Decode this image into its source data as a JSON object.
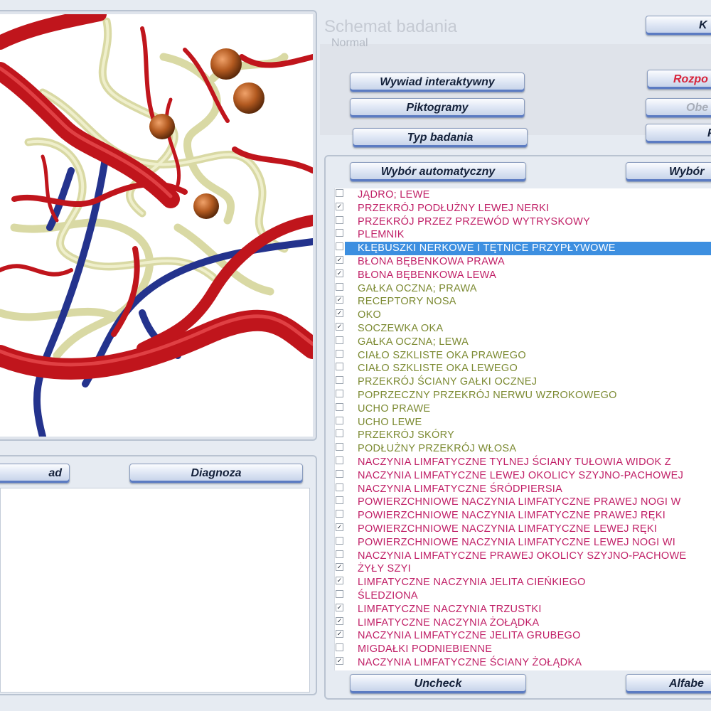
{
  "header": {
    "title": "Schemat badania",
    "subtitle": "Normal",
    "top_button": "K"
  },
  "buttons": {
    "interactive": "Wywiad interaktywny",
    "pictograms": "Piktogramy",
    "exam_type": "Typ badania",
    "auto": "Wybór automatyczny",
    "manual": "Wybór",
    "start": "Rozpo",
    "observe": "Obe",
    "right3": "P",
    "left_bottom": "ad",
    "diagnosis": "Diagnoza",
    "uncheck": "Uncheck",
    "alpha": "Alfabe"
  },
  "colors": {
    "selected_row": "#3d8fe0",
    "organ_text": "#7c8a32",
    "vessel_text": "#c01f66",
    "artery": "#c0151c",
    "vein": "#24338d",
    "lymph": "#e8e8b8",
    "node": "#b35a20"
  },
  "items": [
    {
      "label": "JĄDRO;  LEWE",
      "checked": false,
      "color": "#c01f66"
    },
    {
      "label": "PRZEKRÓJ PODŁUŻNY LEWEJ NERKI",
      "checked": true,
      "color": "#c01f66"
    },
    {
      "label": "PRZEKRÓJ PRZEZ PRZEWÓD WYTRYSKOWY",
      "checked": false,
      "color": "#c01f66"
    },
    {
      "label": "PLEMNIK",
      "checked": false,
      "color": "#c01f66"
    },
    {
      "label": "KŁĘBUSZKI NERKOWE I TĘTNICE PRZYPŁYWOWE",
      "checked": false,
      "color": "#ffffff",
      "selected": true
    },
    {
      "label": "BŁONA BĘBENKOWA PRAWA",
      "checked": true,
      "color": "#c01f66"
    },
    {
      "label": "BŁONA BĘBENKOWA LEWA",
      "checked": true,
      "color": "#c01f66"
    },
    {
      "label": "GAŁKA OCZNA;  PRAWA",
      "checked": false,
      "color": "#7c8a32"
    },
    {
      "label": "RECEPTORY NOSA",
      "checked": true,
      "color": "#7c8a32"
    },
    {
      "label": "OKO",
      "checked": true,
      "color": "#7c8a32"
    },
    {
      "label": "SOCZEWKA OKA",
      "checked": true,
      "color": "#7c8a32"
    },
    {
      "label": "GAŁKA OCZNA;  LEWA",
      "checked": false,
      "color": "#7c8a32"
    },
    {
      "label": "CIAŁO SZKLISTE OKA PRAWEGO",
      "checked": false,
      "color": "#7c8a32"
    },
    {
      "label": "CIAŁO SZKLISTE OKA LEWEGO",
      "checked": false,
      "color": "#7c8a32"
    },
    {
      "label": "PRZEKRÓJ ŚCIANY GAŁKI OCZNEJ",
      "checked": false,
      "color": "#7c8a32"
    },
    {
      "label": "POPRZECZNY PRZEKRÓJ NERWU WZROKOWEGO",
      "checked": false,
      "color": "#7c8a32"
    },
    {
      "label": "UCHO PRAWE",
      "checked": false,
      "color": "#7c8a32"
    },
    {
      "label": "UCHO LEWE",
      "checked": false,
      "color": "#7c8a32"
    },
    {
      "label": "PRZEKRÓJ SKÓRY",
      "checked": false,
      "color": "#7c8a32"
    },
    {
      "label": "PODŁUŻNY  PRZEKRÓJ  WŁOSA",
      "checked": false,
      "color": "#7c8a32"
    },
    {
      "label": "NACZYNIA LIMFATYCZNE TYLNEJ ŚCIANY TUŁOWIA WIDOK Z",
      "checked": false,
      "color": "#c01f66"
    },
    {
      "label": "NACZYNIA LIMFATYCZNE LEWEJ OKOLICY SZYJNO-PACHOWEJ",
      "checked": false,
      "color": "#c01f66"
    },
    {
      "label": "NACZYNIA LIMFATYCZNE ŚRÓDPIERSIA",
      "checked": false,
      "color": "#c01f66"
    },
    {
      "label": "POWIERZCHNIOWE NACZYNIA LIMFATYCZNE PRAWEJ NOGI W",
      "checked": false,
      "color": "#c01f66"
    },
    {
      "label": "POWIERZCHNIOWE NACZYNIA LIMFATYCZNE PRAWEJ RĘKI",
      "checked": false,
      "color": "#c01f66"
    },
    {
      "label": "POWIERZCHNIOWE NACZYNIA LIMFATYCZNE LEWEJ RĘKI",
      "checked": true,
      "color": "#c01f66"
    },
    {
      "label": "POWIERZCHNIOWE NACZYNIA LIMFATYCZNE LEWEJ NOGI WI",
      "checked": false,
      "color": "#c01f66"
    },
    {
      "label": "NACZYNIA LIMFATYCZNE PRAWEJ OKOLICY SZYJNO-PACHOWE",
      "checked": false,
      "color": "#c01f66"
    },
    {
      "label": "ŻYŁY SZYI",
      "checked": true,
      "color": "#c01f66"
    },
    {
      "label": "LIMFATYCZNE NACZYNIA JELITA CIEŃKIEGO",
      "checked": true,
      "color": "#c01f66"
    },
    {
      "label": "ŚLEDZIONA",
      "checked": false,
      "color": "#c01f66"
    },
    {
      "label": "LIMFATYCZNE NACZYNIA TRZUSTKI",
      "checked": true,
      "color": "#c01f66"
    },
    {
      "label": "LIMFATYCZNE NACZYNIA ŻOŁĄDKA",
      "checked": true,
      "color": "#c01f66"
    },
    {
      "label": "NACZYNIA LIMFATYCZNE JELITA GRUBEGO",
      "checked": true,
      "color": "#c01f66"
    },
    {
      "label": "MIGDAŁKI PODNIEBIENNE",
      "checked": false,
      "color": "#c01f66"
    },
    {
      "label": "NACZYNIA LIMFATYCZNE ŚCIANY ŻOŁĄDKA",
      "checked": true,
      "color": "#c01f66"
    }
  ]
}
